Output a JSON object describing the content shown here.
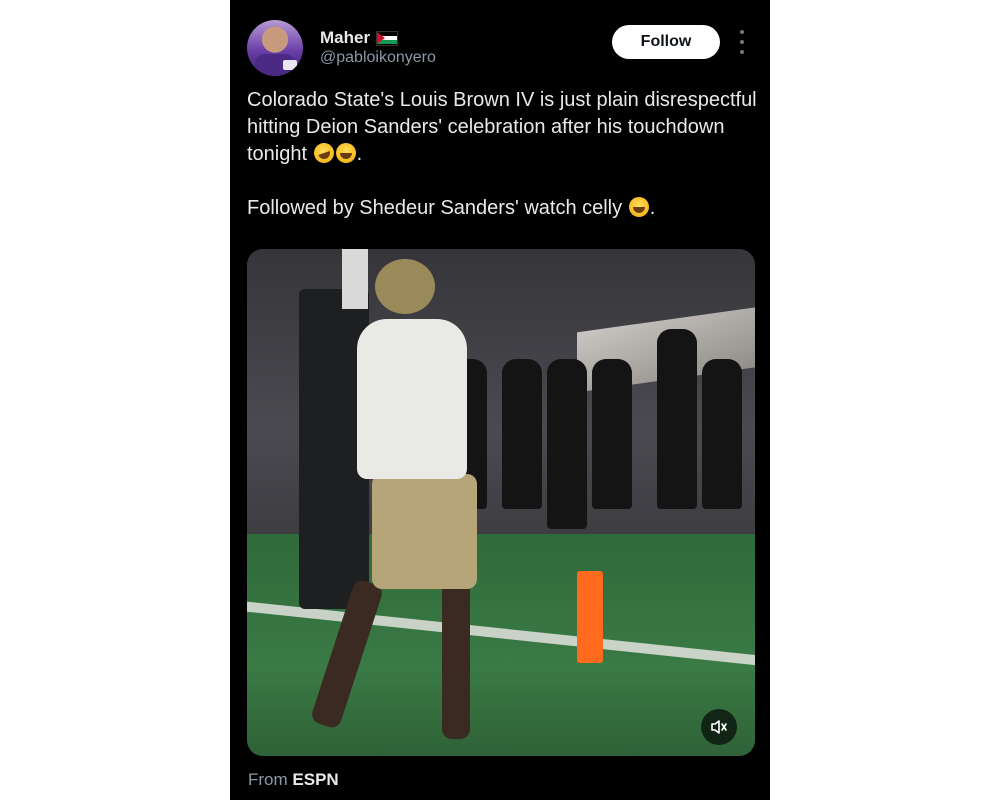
{
  "author": {
    "display_name": "Maher",
    "handle": "@pabloikonyero",
    "flag_icon": "palestine-flag-icon"
  },
  "actions": {
    "follow_label": "Follow",
    "more_icon": "more-vertical-icon"
  },
  "tweet": {
    "line1": "Colorado State's Louis Brown IV is just plain disrespectful hitting Deion Sanders' celebration after his touchdown tonight",
    "line1_end": ".",
    "line2": "Followed by Shedeur Sanders' watch celly",
    "line2_end": "."
  },
  "media": {
    "mute_icon": "speaker-muted-icon"
  },
  "source": {
    "prefix": "From",
    "name": "ESPN"
  },
  "colors": {
    "background": "#000000",
    "text": "#e7e9ea",
    "secondary_text": "#8b98a5",
    "button_bg": "#ffffff"
  }
}
